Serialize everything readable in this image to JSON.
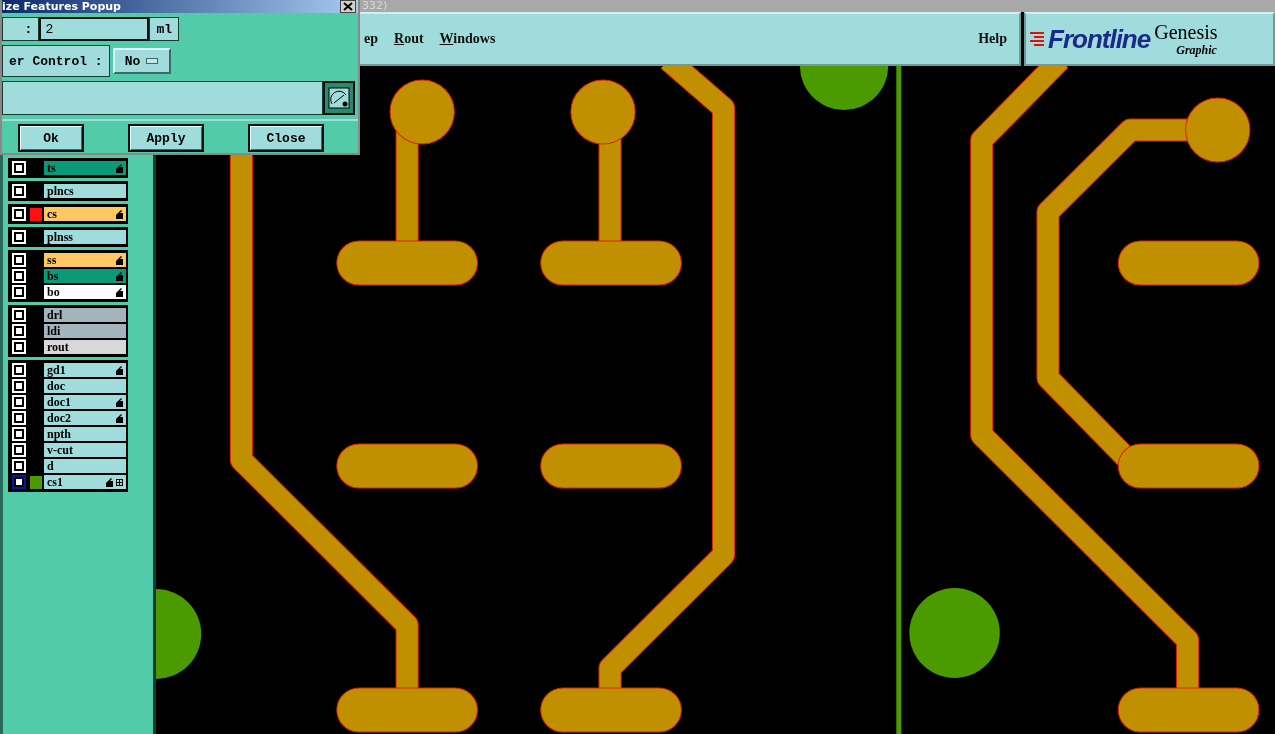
{
  "window": {
    "title_fragment": "332)"
  },
  "popup": {
    "title": "ize Features Popup",
    "size_row": {
      "label": ":",
      "value": "2",
      "unit": "ml"
    },
    "control_row": {
      "label": "er Control :",
      "option": "No"
    },
    "buttons": [
      "Ok",
      "Apply",
      "Close"
    ]
  },
  "menu": {
    "items": [
      {
        "label": "ep",
        "underline_first": false
      },
      {
        "label": "Rout",
        "underline_first": true
      },
      {
        "label": "Windows",
        "underline_first": true
      }
    ],
    "help": "Help"
  },
  "logo": {
    "brand": "Frontline",
    "product": "Genesis",
    "subtitle": "Graphic"
  },
  "layer_groups": [
    [
      {
        "name": "ts",
        "color": "#0a9a78",
        "affected": true,
        "selected": false
      }
    ],
    [
      {
        "name": "plncs",
        "color": "#a0dcdc",
        "affected": false,
        "selected": false
      }
    ],
    [
      {
        "name": "cs",
        "color": "#ffc862",
        "swatch": {
          "color": "#ff1010"
        },
        "affected": true,
        "selected": false
      }
    ],
    [
      {
        "name": "plnss",
        "color": "#a0dcdc",
        "affected": false,
        "selected": false
      }
    ],
    [
      {
        "name": "ss",
        "color": "#ffc862",
        "affected": true,
        "selected": false
      },
      {
        "name": "bs",
        "color": "#0a9a78",
        "affected": true,
        "selected": false
      },
      {
        "name": "bo",
        "color": "#ffffff",
        "affected": true,
        "selected": false
      }
    ],
    [
      {
        "name": "drl",
        "color": "#a3b4bc",
        "affected": false,
        "selected": false
      },
      {
        "name": "ldi",
        "color": "#a3b4bc",
        "affected": false,
        "selected": false
      },
      {
        "name": "rout",
        "color": "#d8d8d8",
        "affected": false,
        "selected": false
      }
    ],
    [
      {
        "name": "gd1",
        "color": "#a0dcdc",
        "affected": true,
        "selected": false
      },
      {
        "name": "doc",
        "color": "#a0dcdc",
        "affected": false,
        "selected": false
      },
      {
        "name": "doc1",
        "color": "#a0dcdc",
        "affected": true,
        "selected": false
      },
      {
        "name": "doc2",
        "color": "#a0dcdc",
        "affected": true,
        "selected": false
      },
      {
        "name": "npth",
        "color": "#a0dcdc",
        "affected": false,
        "selected": false
      },
      {
        "name": "v-cut",
        "color": "#a0dcdc",
        "affected": false,
        "selected": false
      },
      {
        "name": "d",
        "color": "#a0dcdc",
        "affected": false,
        "selected": false
      },
      {
        "name": "cs1",
        "color": "#a0dcdc",
        "swatch": {
          "color": "#4a9a00"
        },
        "affected": true,
        "expandable": true,
        "selected": true
      }
    ]
  ]
}
